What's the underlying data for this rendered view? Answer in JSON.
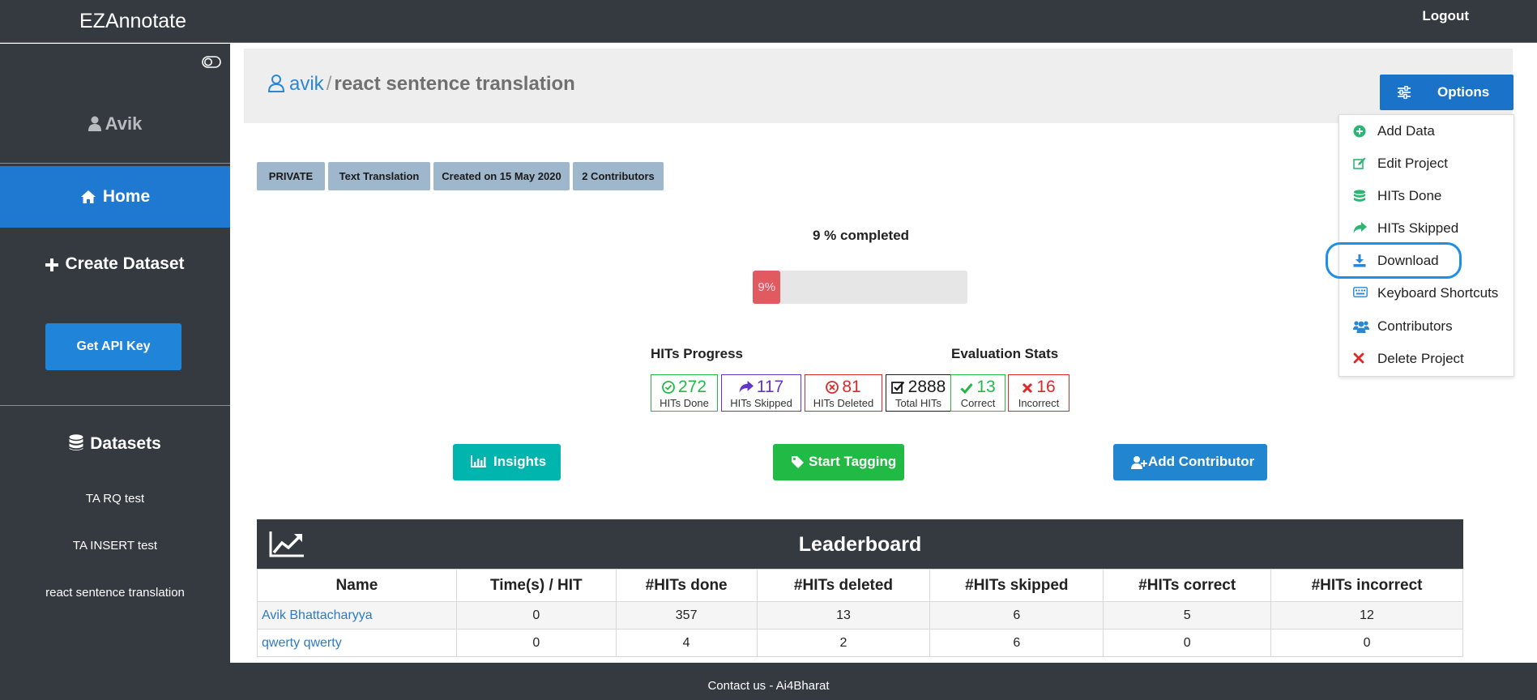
{
  "app": {
    "brand": "EZAnnotate",
    "logout": "Logout"
  },
  "sidebar": {
    "user": "Avik",
    "home": "Home",
    "create_dataset": "Create Dataset",
    "api_key": "Get API Key",
    "datasets_heading": "Datasets",
    "datasets": [
      "TA RQ test",
      "TA INSERT test",
      "react sentence translation"
    ]
  },
  "breadcrumb": {
    "owner": "avik",
    "separator": "/",
    "project": "react sentence translation"
  },
  "options": {
    "label": "Options",
    "menu": [
      {
        "label": "Add Data",
        "icon": "plus-circle-icon",
        "color": "#2bb673"
      },
      {
        "label": "Edit Project",
        "icon": "edit-icon",
        "color": "#2bb673"
      },
      {
        "label": "HITs Done",
        "icon": "database-icon",
        "color": "#2bb673"
      },
      {
        "label": "HITs Skipped",
        "icon": "share-icon",
        "color": "#2bb673"
      },
      {
        "label": "Download",
        "icon": "download-icon",
        "color": "#2b87d1"
      },
      {
        "label": "Keyboard Shortcuts",
        "icon": "keyboard-icon",
        "color": "#2b87d1"
      },
      {
        "label": "Contributors",
        "icon": "users-icon",
        "color": "#2b87d1"
      },
      {
        "label": "Delete Project",
        "icon": "close-icon",
        "color": "#db2828"
      }
    ]
  },
  "tags": [
    "PRIVATE",
    "Text Translation",
    "Created on 15 May 2020",
    "2 Contributors"
  ],
  "progress": {
    "text": "9 % completed",
    "percent": 9,
    "label": "9%"
  },
  "hits_progress": {
    "title": "HITs Progress",
    "stats": [
      {
        "value": "272",
        "label": "HITs Done",
        "color": "#21ba45"
      },
      {
        "value": "117",
        "label": "HITs Skipped",
        "color": "#6435c9"
      },
      {
        "value": "81",
        "label": "HITs Deleted",
        "color": "#db2828"
      }
    ]
  },
  "evaluation_stats": {
    "title": "Evaluation Stats",
    "stats": [
      {
        "value": "2888",
        "label": "Total HITs",
        "color": "#1b1c1d"
      },
      {
        "value": "13",
        "label": "Correct",
        "color": "#21ba45"
      },
      {
        "value": "16",
        "label": "Incorrect",
        "color": "#db2828"
      }
    ]
  },
  "actions": {
    "insights": "Insights",
    "start_tagging": "Start Tagging",
    "add_contributor": "Add Contributor"
  },
  "leaderboard": {
    "title": "Leaderboard",
    "columns": [
      "Name",
      "Time(s) / HIT",
      "#HITs done",
      "#HITs deleted",
      "#HITs skipped",
      "#HITs correct",
      "#HITs incorrect"
    ],
    "rows": [
      [
        "Avik Bhattacharyya",
        "0",
        "357",
        "13",
        "6",
        "5",
        "12"
      ],
      [
        "qwerty qwerty",
        "0",
        "4",
        "2",
        "6",
        "0",
        "0"
      ]
    ]
  },
  "footer": "Contact us - Ai4Bharat"
}
